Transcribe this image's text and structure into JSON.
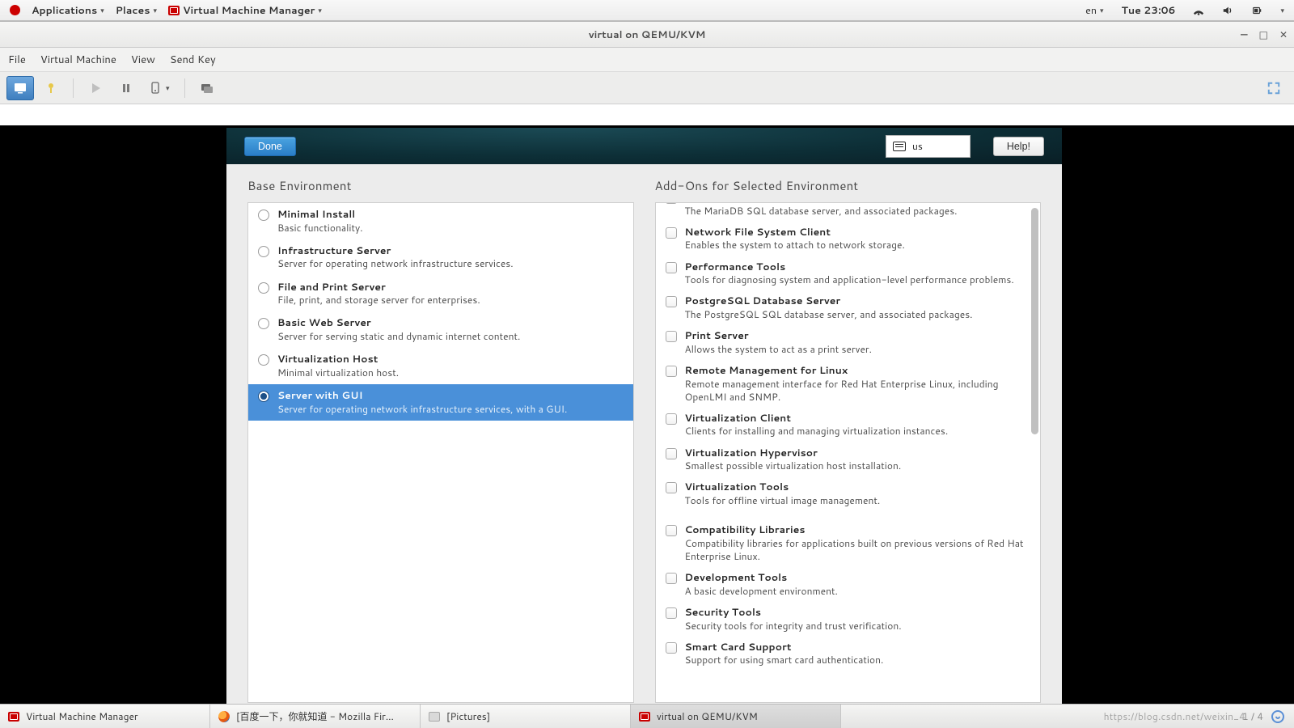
{
  "topbar": {
    "applications": "Applications",
    "places": "Places",
    "appname": "Virtual Machine Manager",
    "lang": "en",
    "clock": "Tue 23:06"
  },
  "window": {
    "title": "virtual on QEMU/KVM",
    "menu": {
      "file": "File",
      "vm": "Virtual Machine",
      "view": "View",
      "sendkey": "Send Key"
    }
  },
  "anaconda": {
    "done": "Done",
    "help": "Help!",
    "kbd_layout": "us",
    "left_heading": "Base Environment",
    "right_heading": "Add-Ons for Selected Environment",
    "environments": [
      {
        "title": "Minimal Install",
        "desc": "Basic functionality.",
        "selected": false
      },
      {
        "title": "Infrastructure Server",
        "desc": "Server for operating network infrastructure services.",
        "selected": false
      },
      {
        "title": "File and Print Server",
        "desc": "File, print, and storage server for enterprises.",
        "selected": false
      },
      {
        "title": "Basic Web Server",
        "desc": "Server for serving static and dynamic internet content.",
        "selected": false
      },
      {
        "title": "Virtualization Host",
        "desc": "Minimal virtualization host.",
        "selected": false
      },
      {
        "title": "Server with GUI",
        "desc": "Server for operating network infrastructure services, with a GUI.",
        "selected": true
      }
    ],
    "addons_groupA": [
      {
        "title": "MariaDB Database Server",
        "desc": "The MariaDB SQL database server, and associated packages.",
        "cut": true
      },
      {
        "title": "Network File System Client",
        "desc": "Enables the system to attach to network storage."
      },
      {
        "title": "Performance Tools",
        "desc": "Tools for diagnosing system and application-level performance problems."
      },
      {
        "title": "PostgreSQL Database Server",
        "desc": "The PostgreSQL SQL database server, and associated packages."
      },
      {
        "title": "Print Server",
        "desc": "Allows the system to act as a print server."
      },
      {
        "title": "Remote Management for Linux",
        "desc": "Remote management interface for Red Hat Enterprise Linux, including OpenLMI and SNMP."
      },
      {
        "title": "Virtualization Client",
        "desc": "Clients for installing and managing virtualization instances."
      },
      {
        "title": "Virtualization Hypervisor",
        "desc": "Smallest possible virtualization host installation."
      },
      {
        "title": "Virtualization Tools",
        "desc": "Tools for offline virtual image management."
      }
    ],
    "addons_groupB": [
      {
        "title": "Compatibility Libraries",
        "desc": "Compatibility libraries for applications built on previous versions of Red Hat Enterprise Linux."
      },
      {
        "title": "Development Tools",
        "desc": "A basic development environment."
      },
      {
        "title": "Security Tools",
        "desc": "Security tools for integrity and trust verification."
      },
      {
        "title": "Smart Card Support",
        "desc": "Support for using smart card authentication."
      }
    ]
  },
  "taskbar": {
    "t1": "Virtual Machine Manager",
    "t2": "[百度一下，你就知道 - Mozilla Fir...",
    "t3": "[Pictures]",
    "t4": "virtual on QEMU/KVM",
    "pager": "1 / 4"
  },
  "watermark": "https://blog.csdn.net/weixin_4"
}
